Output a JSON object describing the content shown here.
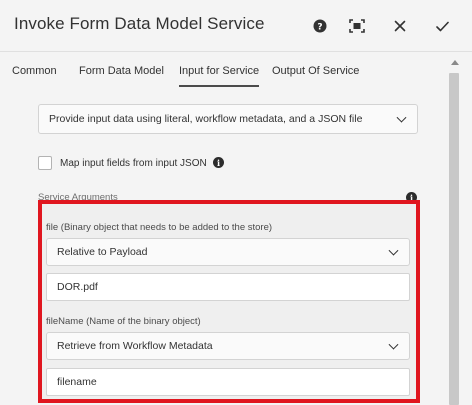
{
  "dialog": {
    "title": "Invoke Form Data Model Service",
    "icons": {
      "help": "help-icon",
      "fullscreen": "fullscreen-icon",
      "close": "close-icon",
      "done": "check-icon"
    }
  },
  "tabs": [
    {
      "label": "Common",
      "active": false
    },
    {
      "label": "Form Data Model",
      "active": false
    },
    {
      "label": "Input for Service",
      "active": true
    },
    {
      "label": "Output Of Service",
      "active": false
    }
  ],
  "input_mode": {
    "selected": "Provide input data using literal, workflow metadata, and a JSON file"
  },
  "map_fields": {
    "label": "Map input fields from input JSON",
    "checked": false
  },
  "service_arguments": {
    "heading": "Service Arguments",
    "args": [
      {
        "label": "file (Binary object that needs to be added to the store)",
        "mode": "Relative to Payload",
        "value": "DOR.pdf"
      },
      {
        "label": "fileName (Name of the binary object)",
        "mode": "Retrieve from Workflow Metadata",
        "value": "filename"
      }
    ]
  },
  "colors": {
    "highlight_border": "#e0161f",
    "panel_background": "#f4f4f4"
  }
}
